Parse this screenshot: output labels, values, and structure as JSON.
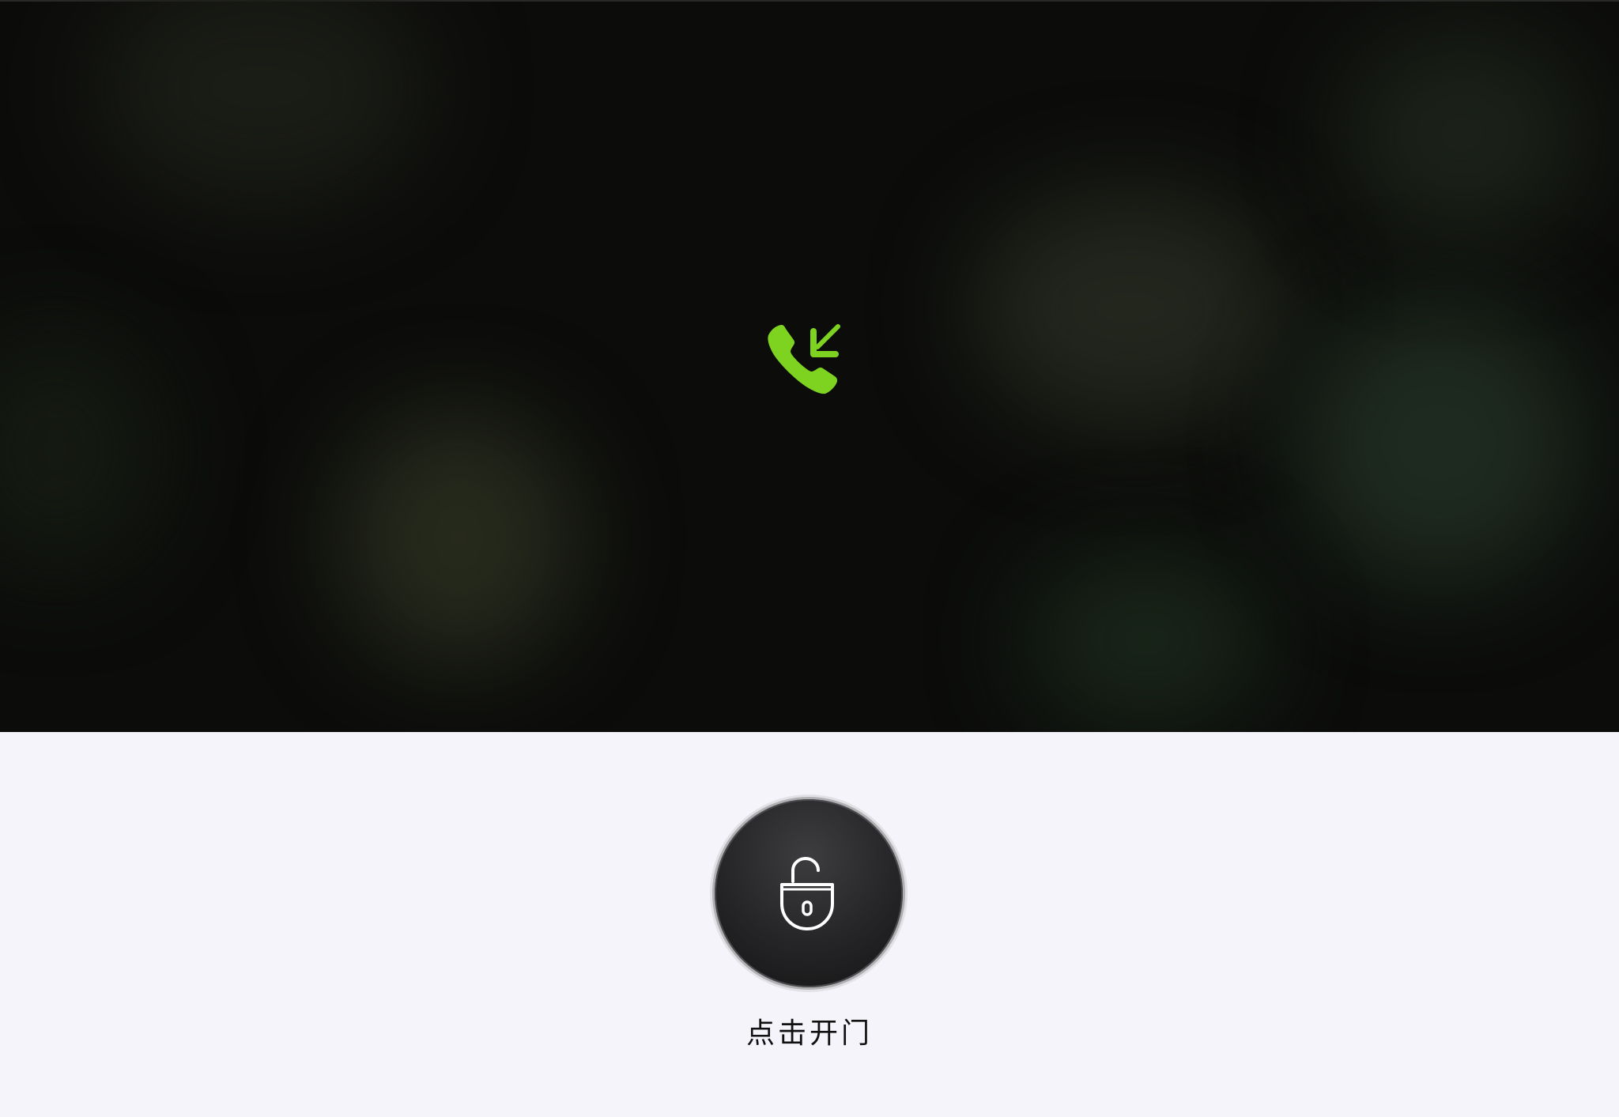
{
  "video": {
    "status_icon": "incoming-call-icon",
    "icon_color": "#7ed321"
  },
  "controls": {
    "unlock_icon": "unlocked-padlock-icon",
    "unlock_label": "点击开门"
  },
  "colors": {
    "video_background": "#0c0d0b",
    "panel_background": "#f4f4fa",
    "button_background": "#252527",
    "label_text": "#111111"
  }
}
